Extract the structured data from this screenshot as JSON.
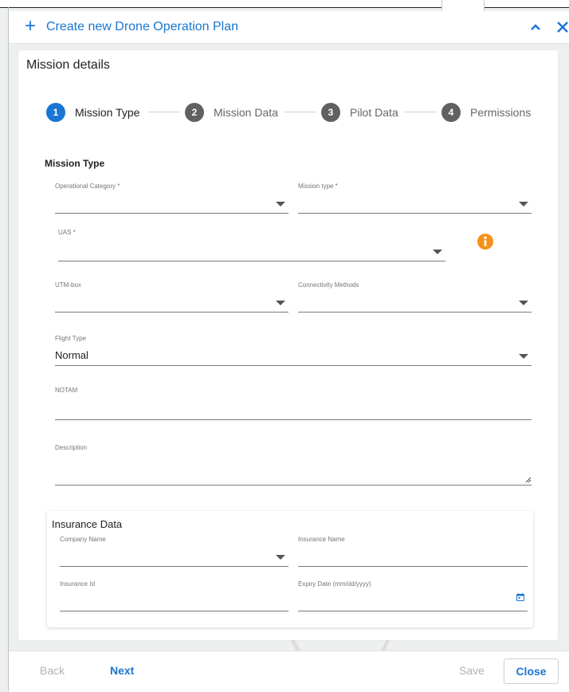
{
  "header": {
    "title": "Create new Drone Operation Plan"
  },
  "panel": {
    "title": "Mission details"
  },
  "stepper": [
    {
      "num": "1",
      "label": "Mission Type"
    },
    {
      "num": "2",
      "label": "Mission Data"
    },
    {
      "num": "3",
      "label": "Pilot Data"
    },
    {
      "num": "4",
      "label": "Permissions"
    }
  ],
  "form": {
    "section_title": "Mission Type",
    "operational_category": {
      "label": "Operational Category *",
      "value": ""
    },
    "mission_type": {
      "label": "Mission type *",
      "value": ""
    },
    "uas": {
      "label": "UAS *",
      "value": ""
    },
    "utm_box": {
      "label": "UTM-box",
      "value": ""
    },
    "connectivity_methods": {
      "label": "Connectivity Methods",
      "value": ""
    },
    "flight_type": {
      "label": "Flight Type",
      "value": "Normal"
    },
    "notam": {
      "label": "NOTAM",
      "value": ""
    },
    "description": {
      "label": "Description",
      "value": ""
    }
  },
  "insurance": {
    "title": "Insurance Data",
    "company_name": {
      "label": "Company Name",
      "value": ""
    },
    "insurance_name": {
      "label": "Insurance Name",
      "value": ""
    },
    "insurance_id": {
      "label": "Insurance Id",
      "value": ""
    },
    "expiry_date": {
      "label": "Expiry Date (mm/dd/yyyy)",
      "value": ""
    }
  },
  "footer": {
    "back": "Back",
    "next": "Next",
    "save": "Save",
    "close": "Close"
  },
  "colors": {
    "primary": "#1976d2",
    "info": "#f5921e",
    "step_inactive": "#616161"
  },
  "icons": {
    "header_add": "plus-icon",
    "collapse": "chevron-up-icon",
    "close": "close-icon",
    "info": "info-icon",
    "calendar": "calendar-icon"
  }
}
